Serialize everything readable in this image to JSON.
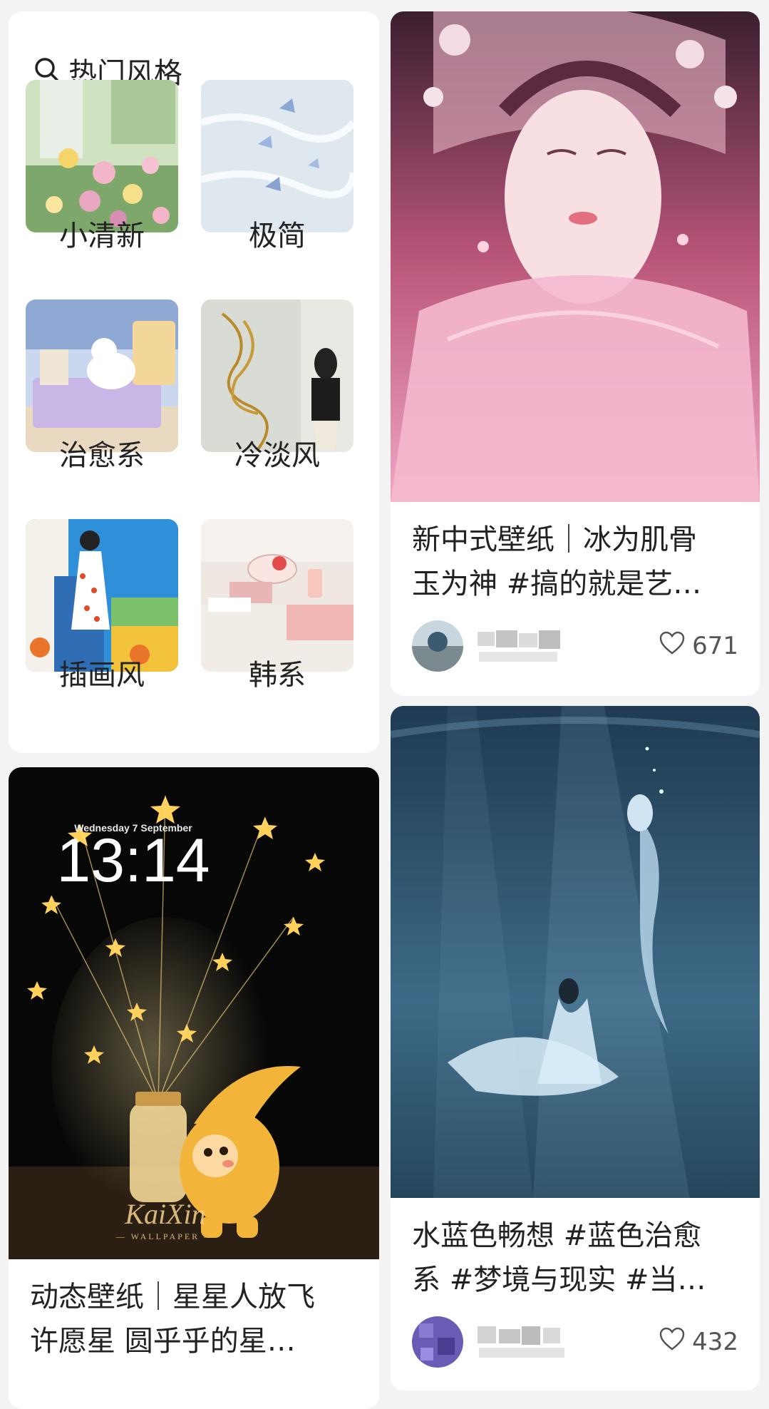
{
  "hot_styles": {
    "title": "热门风格",
    "items": [
      {
        "label": "小清新"
      },
      {
        "label": "极简"
      },
      {
        "label": "治愈系"
      },
      {
        "label": "冷淡风"
      },
      {
        "label": "插画风"
      },
      {
        "label": "韩系"
      }
    ]
  },
  "posts": [
    {
      "title": "新中式壁纸｜冰为肌骨玉为神 #搞的就是艺…",
      "title_line1": "新中式壁纸｜冰为肌骨",
      "title_line2": "玉为神 #搞的就是艺…",
      "likes": "671"
    },
    {
      "title_line1": "水蓝色畅想 #蓝色治愈",
      "title_line2": "系 #梦境与现实 #当…",
      "likes": "432"
    },
    {
      "title_line1": "动态壁纸｜星星人放飞",
      "title_line2": "许愿星 圆乎乎的星…",
      "image_text": {
        "date": "Wednesday 7 September",
        "time": "13:14",
        "brand": "KaiXin",
        "brand_sub": "— WALLPAPER —"
      }
    }
  ],
  "colors": {
    "page_bg": "#f3f3f3",
    "card_bg": "#ffffff",
    "text": "#222222",
    "muted": "#555555"
  }
}
